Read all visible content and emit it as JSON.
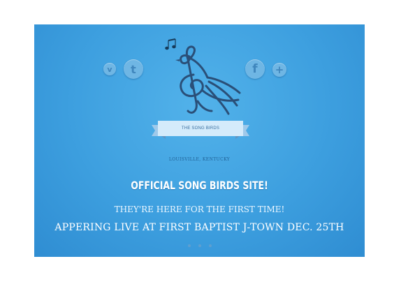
{
  "social": {
    "vimeo_glyph": "v",
    "twitter_glyph": "t",
    "facebook_glyph": "f",
    "add_glyph": "+"
  },
  "brand": {
    "ribbon_text": "THE SONG BIRDS",
    "location": "LOUISVILLE, KENTUCKY"
  },
  "main": {
    "headline": "OFFICIAL SONG BIRDS SITE!",
    "subheading": "THEY'RE HERE FOR THE FIRST TIME!",
    "announcement": "APPERING LIVE AT FIRST BAPTIST J-TOWN DEC. 25TH"
  },
  "colors": {
    "background": "#3d9fdf",
    "accent_dark": "#1f5f93",
    "ribbon": "#cfe8fa"
  },
  "icons": [
    "vimeo-icon",
    "twitter-icon",
    "facebook-icon",
    "plus-icon",
    "music-notes-icon",
    "treble-clef-bird-logo"
  ]
}
